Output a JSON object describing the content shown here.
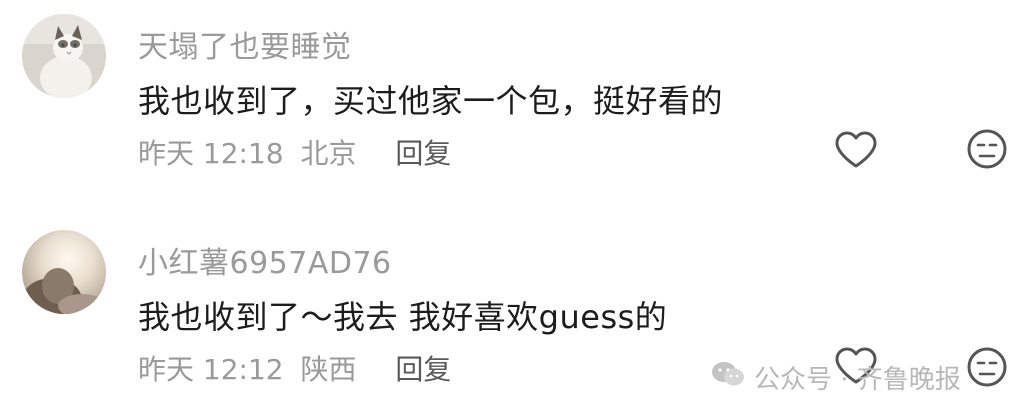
{
  "comments": [
    {
      "username": "天塌了也要睡觉",
      "text": "我也收到了，买过他家一个包，挺好看的",
      "time": "昨天 12:18",
      "location": "北京",
      "reply_label": "回复",
      "like_icon": "heart-outline-icon",
      "dislike_icon": "meh-face-icon",
      "avatar": "cat-avatar"
    },
    {
      "username": "小红薯6957AD76",
      "text": "我也收到了～我去  我好喜欢guess的",
      "time": "昨天 12:12",
      "location": "陕西",
      "reply_label": "回复",
      "like_icon": "heart-outline-icon",
      "dislike_icon": "meh-face-icon",
      "avatar": "photo-avatar"
    }
  ],
  "watermark": {
    "text": "公众号 · 齐鲁晚报",
    "logo_icon": "wechat-official-account-icon"
  },
  "colors": {
    "text_primary": "#1c1c1c",
    "text_secondary": "#9a9a9a",
    "reply_text": "#5a5a5a",
    "icon_stroke": "#555555"
  }
}
